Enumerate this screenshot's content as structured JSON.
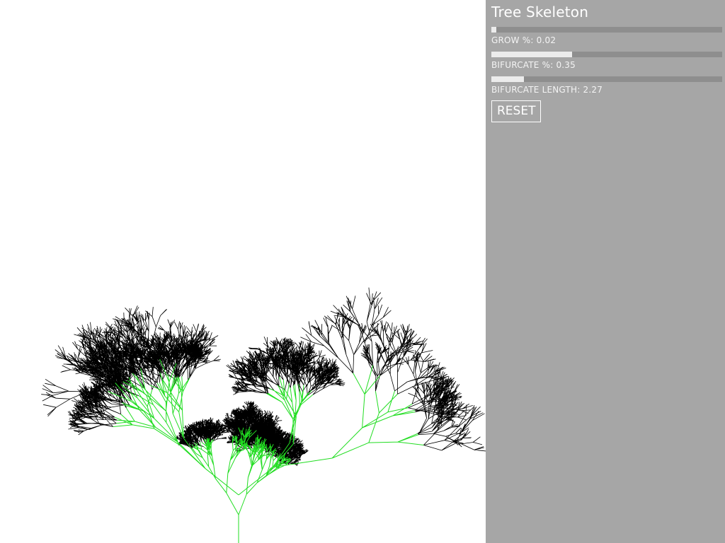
{
  "panel": {
    "title": "Tree Skeleton",
    "sliders": [
      {
        "name": "GROW %",
        "value": 0.02,
        "display": "0.02",
        "fill_fraction": 0.02
      },
      {
        "name": "BIFURCATE %",
        "value": 0.35,
        "display": "0.35",
        "fill_fraction": 0.35
      },
      {
        "name": "BIFURCATE LENGTH",
        "value": 2.27,
        "display": "2.27",
        "fill_fraction": 0.14
      }
    ],
    "reset_label": "RESET"
  },
  "colors": {
    "panel_background": "#a6a6a6",
    "slider_track": "#8e8e8e",
    "slider_fill": "#ececec",
    "canvas_background": "#ffffff",
    "branch_green": "#22dd22",
    "twig_black": "#000000"
  },
  "tree": {
    "seed": 7,
    "max_depth": 10
  }
}
